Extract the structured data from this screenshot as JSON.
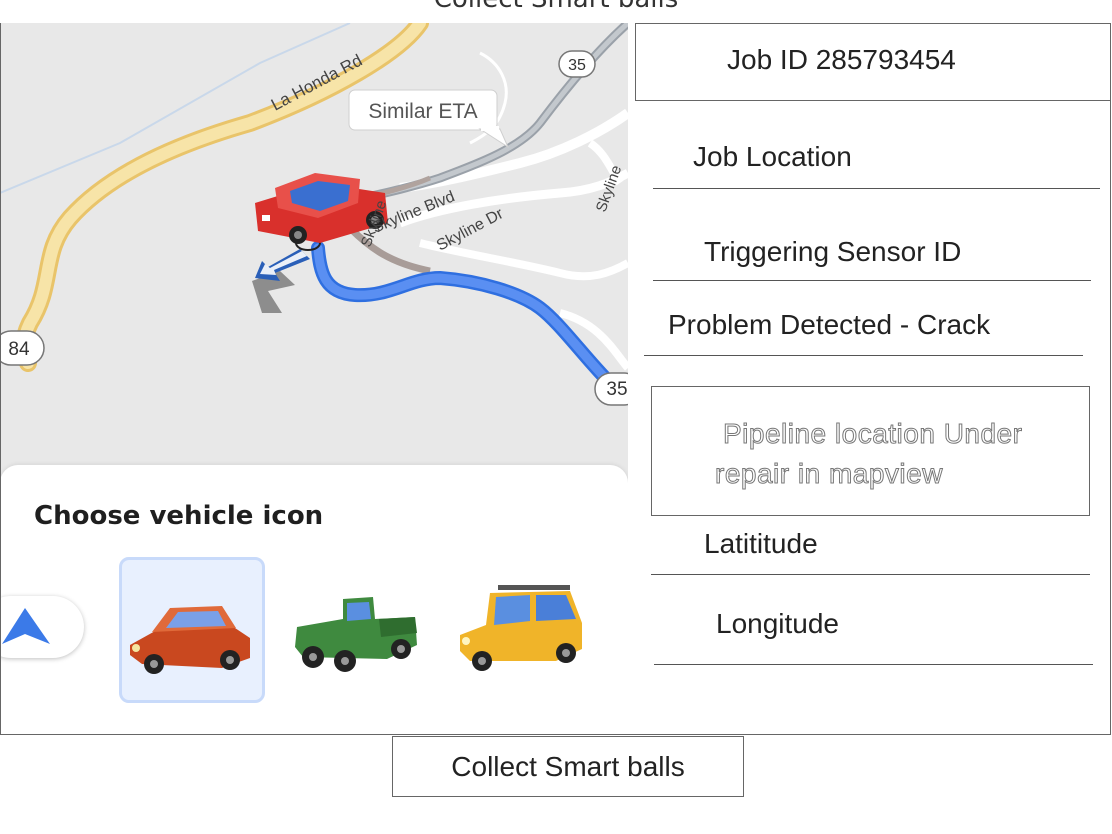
{
  "header": {
    "title": "Collect Smart balls"
  },
  "map": {
    "road_labels": {
      "la_honda": "La Honda Rd",
      "skyline_blvd": "Skyline Blvd",
      "skyline_dr": "Skyline Dr",
      "skyline_side": "Skyline",
      "skyline_vertical": "Skyline"
    },
    "route_shields": {
      "top": "35",
      "right": "35",
      "left": "84"
    },
    "eta_tooltip": "Similar ETA"
  },
  "vehicle_panel": {
    "title": "Choose vehicle icon",
    "options": [
      {
        "name": "navigation-arrow",
        "selected": false
      },
      {
        "name": "sedan",
        "color": "#d9582a",
        "selected": true
      },
      {
        "name": "pickup-truck",
        "color": "#3f8a3f",
        "selected": false
      },
      {
        "name": "suv",
        "color": "#f0b429",
        "selected": false
      }
    ]
  },
  "job": {
    "id_label": "Job ID 285793454",
    "location_label": "Job Location",
    "sensor_label": "Triggering Sensor ID",
    "problem_label": "Problem Detected - Crack",
    "pipeline_line1": "Pipeline location Under",
    "pipeline_line2": "repair in mapview",
    "latitude_label": "Latititude",
    "longitude_label": "Longitude"
  },
  "actions": {
    "collect_button": "Collect Smart balls"
  },
  "colors": {
    "route": "#4a80f0",
    "road_yellow": "#f7d98b",
    "map_bg": "#e8e8e8",
    "selected_bg": "#e8f0fe"
  }
}
